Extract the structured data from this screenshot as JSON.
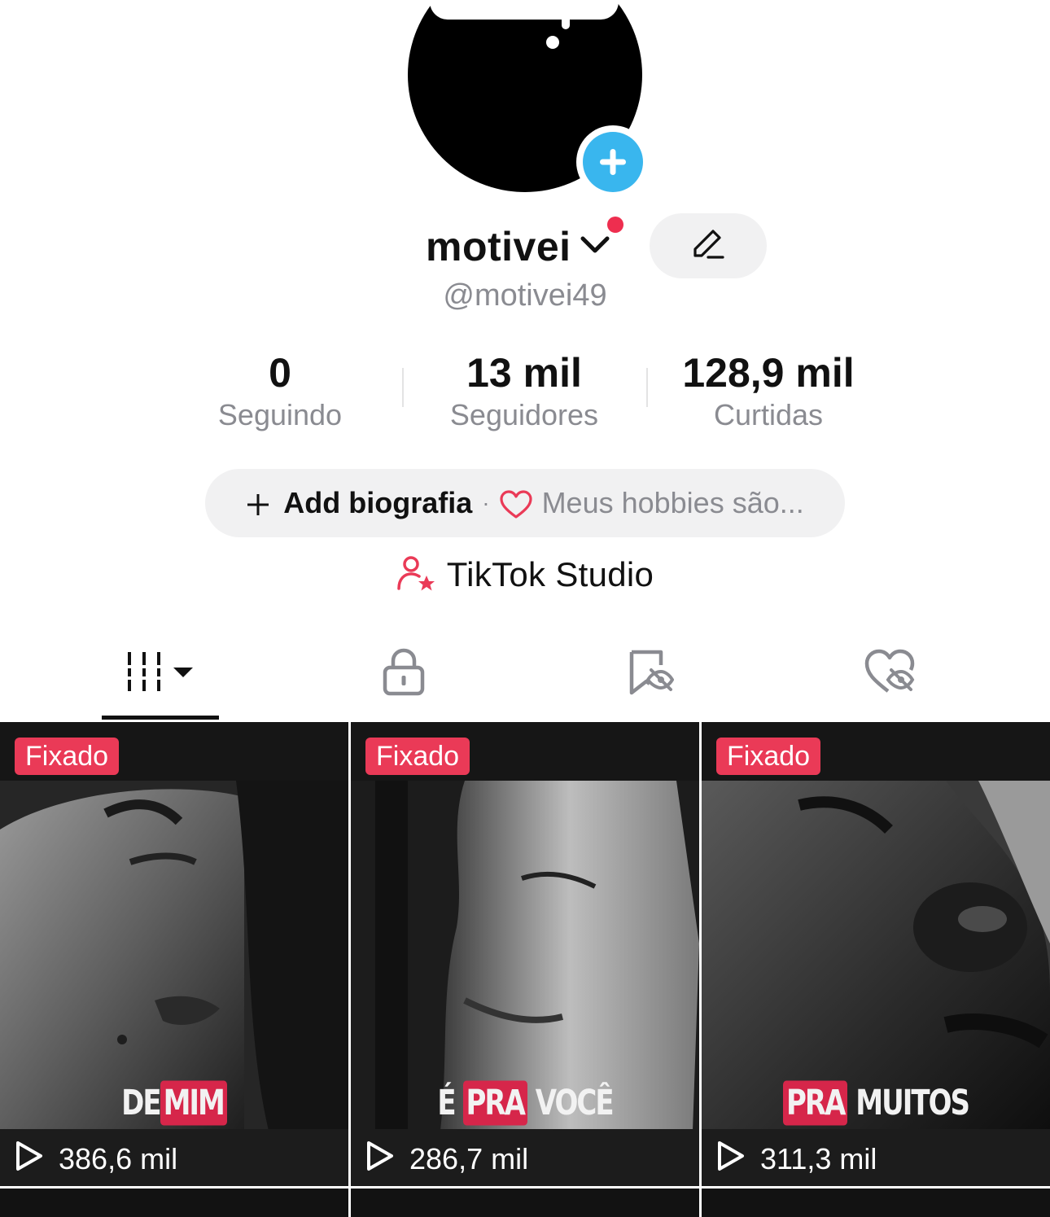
{
  "profile": {
    "display_name": "motivei",
    "username": "@motivei49"
  },
  "stats": [
    {
      "value": "0",
      "label": "Seguindo"
    },
    {
      "value": "13 mil",
      "label": "Seguidores"
    },
    {
      "value": "128,9 mil",
      "label": "Curtidas"
    }
  ],
  "bio": {
    "add_label": "Add biografia",
    "separator": "·",
    "hint": "Meus hobbies são..."
  },
  "studio": {
    "label": "TikTok Studio"
  },
  "tabs": [
    {
      "icon": "videos-grid-icon",
      "active": true
    },
    {
      "icon": "lock-icon",
      "active": false
    },
    {
      "icon": "favorites-hidden-icon",
      "active": false
    },
    {
      "icon": "liked-hidden-icon",
      "active": false
    }
  ],
  "videos": [
    {
      "badge": "Fixado",
      "caption_a": "DE",
      "caption_b": "MIM",
      "views": "386,6 mil"
    },
    {
      "badge": "Fixado",
      "caption_a": "É",
      "caption_b": "PRA",
      "caption_c": "VOCÊ",
      "views": "286,7 mil"
    },
    {
      "badge": "Fixado",
      "caption_a": "PRA",
      "caption_b": "MUITOS",
      "views": "311,3 mil"
    }
  ],
  "colors": {
    "accent": "#ea3a57",
    "notification": "#ee2e4f",
    "add_avatar": "#39b6ee",
    "muted_text": "#8a8b91",
    "pill_bg": "#f1f1f2"
  }
}
